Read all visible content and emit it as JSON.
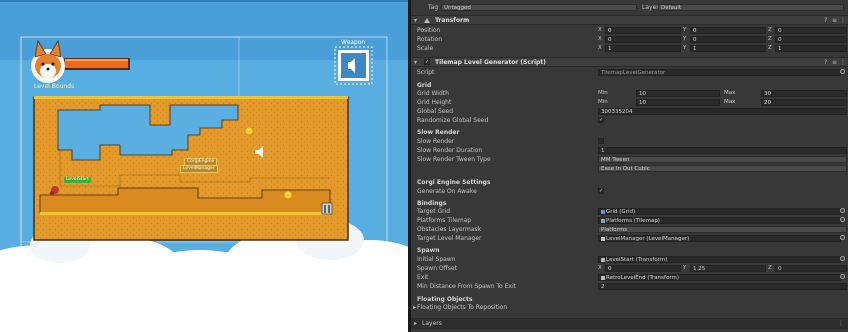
{
  "scene": {
    "level_bounds_label": "Level Bounds",
    "weapon_label": "Weapon",
    "level_start_tag": "LevelStart",
    "gizmo_tag_1": "CorgiEngine",
    "gizmo_tag_2": "LevelManager"
  },
  "inspector": {
    "top": {
      "tag_label": "Tag",
      "tag_value": "Untagged",
      "layer_label": "Layer",
      "layer_value": "Default"
    },
    "transform": {
      "title": "Transform",
      "position_label": "Position",
      "rotation_label": "Rotation",
      "scale_label": "Scale",
      "position": {
        "x": "0",
        "y": "0",
        "z": "0"
      },
      "rotation": {
        "x": "0",
        "y": "0",
        "z": "0"
      },
      "scale": {
        "x": "1",
        "y": "1",
        "z": "1"
      }
    },
    "generator": {
      "title": "Tilemap Level Generator (Script)",
      "script_label": "Script",
      "script_value": "TilemapLevelGenerator",
      "grid_header": "Grid",
      "grid_width_label": "Grid Width",
      "grid_height_label": "Grid Height",
      "min_label": "Min",
      "max_label": "Max",
      "grid_width_min": "10",
      "grid_width_max": "30",
      "grid_height_min": "10",
      "grid_height_max": "20",
      "global_seed_label": "Global Seed",
      "global_seed_value": "300335204",
      "randomize_label": "Randomize Global Seed",
      "slow_header": "Slow Render",
      "slow_render_label": "Slow Render",
      "slow_duration_label": "Slow Render Duration",
      "slow_duration_value": "1",
      "slow_tween_label": "Slow Render Tween Type",
      "tween_value": "MM Tween",
      "ease_value": "Ease In Out Cubic",
      "corgi_header": "Corgi Engine Settings",
      "generate_awake_label": "Generate On Awake",
      "bindings_header": "Bindings",
      "target_grid_label": "Target Grid",
      "target_grid_value": "Grid (Grid)",
      "platforms_tilemap_label": "Platforms Tilemap",
      "platforms_tilemap_value": "Platforms (Tilemap)",
      "obstacles_layermask_label": "Obstacles Layermask",
      "obstacles_layermask_value": "Platforms",
      "target_level_manager_label": "Target Level Manager",
      "target_level_manager_value": "LevelManager (LevelManager)",
      "spawn_header": "Spawn",
      "initial_spawn_label": "Initial Spawn",
      "initial_spawn_value": "LevelStart (Transform)",
      "spawn_offset_label": "Spawn Offset",
      "spawn_offset": {
        "x": "0",
        "y": "1.25",
        "z": "0"
      },
      "exit_label": "Exit",
      "exit_value": "RetroLevelEnd (Transform)",
      "min_distance_label": "Min Distance From Spawn To Exit",
      "min_distance_value": "2",
      "floating_header": "Floating Objects",
      "floating_reposition_label": "Floating Objects To Reposition",
      "layers_label": "Layers"
    },
    "axis": {
      "x": "X",
      "y": "Y",
      "z": "Z"
    }
  }
}
